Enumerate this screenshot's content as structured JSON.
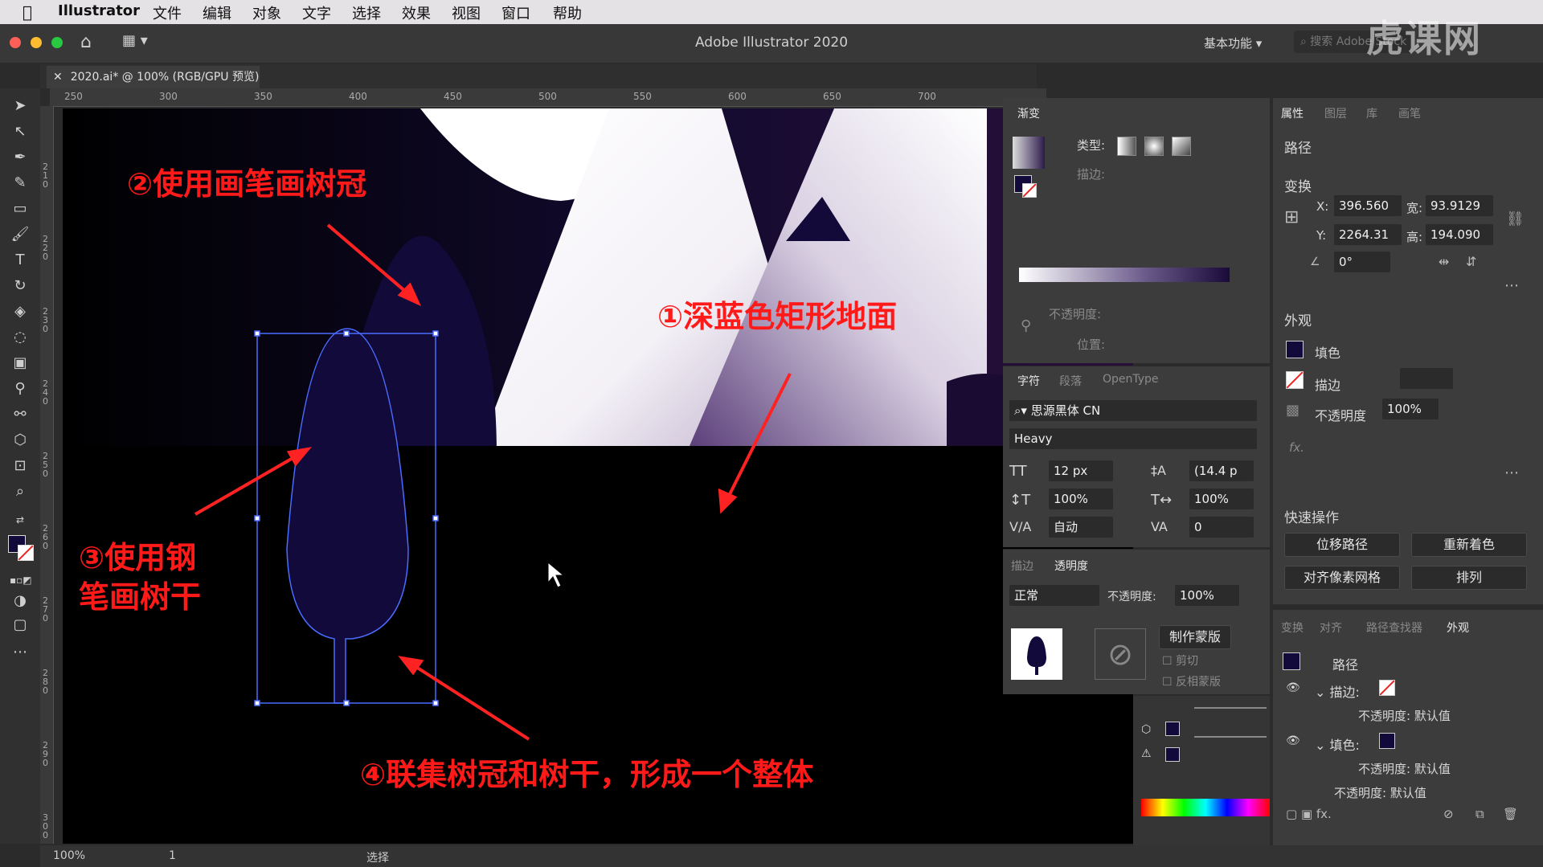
{
  "menubar": {
    "app_name": "Illustrator",
    "items": [
      "文件",
      "编辑",
      "对象",
      "文字",
      "选择",
      "效果",
      "视图",
      "窗口",
      "帮助"
    ]
  },
  "titlebar": {
    "title": "Adobe Illustrator 2020",
    "workspace": "基本功能",
    "search_placeholder": "搜索 Adobe Stock"
  },
  "watermark": "虎课网",
  "document_tab": {
    "label": "2020.ai* @ 100% (RGB/GPU 预览)"
  },
  "ruler": {
    "marks": [
      "250",
      "300",
      "350",
      "400",
      "450",
      "500",
      "550",
      "600",
      "650",
      "700"
    ],
    "vmarks": [
      "210",
      "220",
      "230",
      "240",
      "250",
      "260",
      "270",
      "280",
      "290",
      "300"
    ]
  },
  "annotations": {
    "a1": "①深蓝色矩形地面",
    "a2": "②使用画笔画树冠",
    "a3": "③使用钢\n笔画树干",
    "a4": "④联集树冠和树干，形成一个整体"
  },
  "gradient_panel": {
    "title": "渐变",
    "type_label": "类型:",
    "stroke_label": "描边:",
    "opacity_label": "不透明度:",
    "position_label": "位置:"
  },
  "character_panel": {
    "tabs": [
      "字符",
      "段落",
      "OpenType"
    ],
    "font_family": "思源黑体 CN",
    "font_style": "Heavy",
    "font_size": "12 px",
    "leading": "(14.4 p",
    "vscale": "100%",
    "hscale": "100%",
    "kerning": "自动",
    "tracking": "0"
  },
  "transparency_panel": {
    "tabs": [
      "描边",
      "透明度"
    ],
    "blend_mode": "正常",
    "opacity_label": "不透明度:",
    "opacity_value": "100%",
    "make_mask": "制作蒙版",
    "clip": "剪切",
    "invert_mask": "反相蒙版"
  },
  "properties_panel": {
    "tabs": [
      "属性",
      "图层",
      "库",
      "画笔"
    ],
    "object_type": "路径",
    "transform_title": "变换",
    "x_label": "X:",
    "x_value": "396.560",
    "y_label": "Y:",
    "y_value": "2264.31",
    "w_label": "宽:",
    "w_value": "93.9129",
    "h_label": "高:",
    "h_value": "194.090",
    "angle_value": "0°",
    "appearance_title": "外观",
    "fill_label": "填色",
    "stroke_label": "描边",
    "opacity_label": "不透明度",
    "opacity_value": "100%",
    "fx_label": "fx.",
    "quick_actions_title": "快速操作",
    "btn_offset_path": "位移路径",
    "btn_recolor": "重新着色",
    "btn_align_pixel": "对齐像素网格",
    "btn_arrange": "排列"
  },
  "appearance_panel": {
    "tabs": [
      "变换",
      "对齐",
      "路径查找器",
      "外观"
    ],
    "path_label": "路径",
    "stroke_row": "描边:",
    "fill_row": "填色:",
    "opacity_default": "不透明度: 默认值",
    "opacity_default2": "不透明度: 默认值",
    "opacity_default3": "不透明度: 默认值"
  },
  "status": {
    "zoom": "100%",
    "page": "1",
    "tool": "选择"
  },
  "colors": {
    "tree_fill": "#110a3a",
    "annotation": "#ff1a1a",
    "selection": "#4a6cff",
    "panel_bg": "#3c3c3c"
  }
}
